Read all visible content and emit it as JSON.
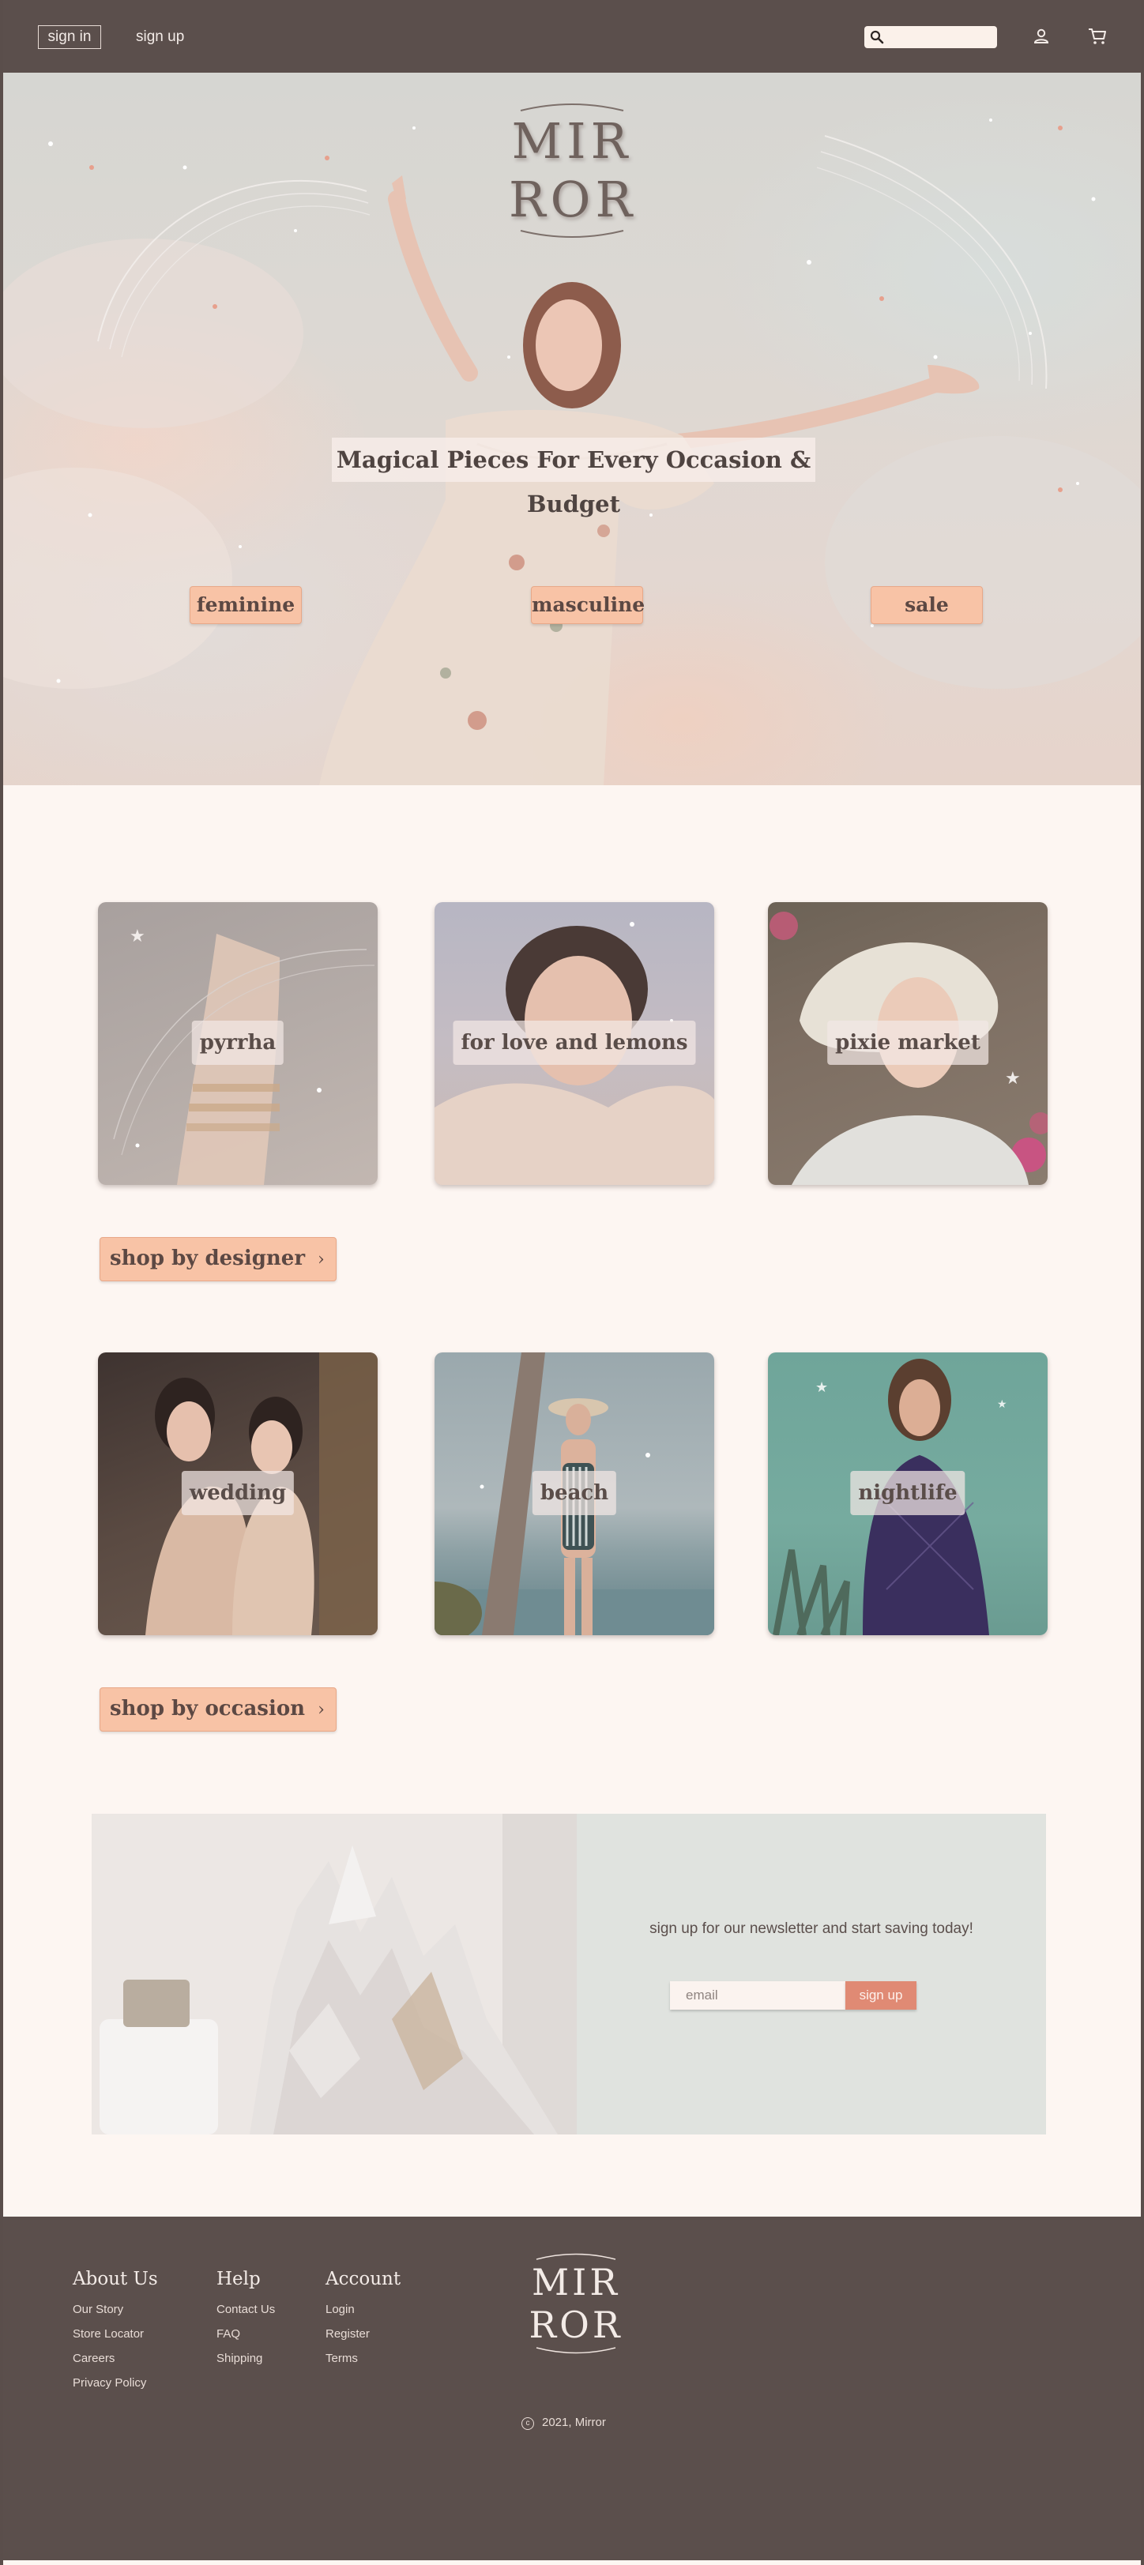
{
  "nav": {
    "sign_in": "sign in",
    "sign_up": "sign up",
    "search_placeholder": "",
    "icons": [
      "search-icon",
      "user-icon",
      "cart-icon"
    ]
  },
  "hero": {
    "logo_line1": "MIR",
    "logo_line2": "ROR",
    "tagline": "Magical Pieces For Every Occasion & Budget",
    "buttons": [
      "feminine",
      "masculine",
      "sale"
    ]
  },
  "designers": {
    "cards": [
      "pyrrha",
      "for love and lemons",
      "pixie market"
    ],
    "cta": "shop by designer"
  },
  "occasions": {
    "cards": [
      "wedding",
      "beach",
      "nightlife"
    ],
    "cta": "shop by occasion"
  },
  "newsletter": {
    "text": "sign up for our newsletter and start saving today!",
    "email_placeholder": "email",
    "button": "sign up"
  },
  "footer": {
    "columns": [
      {
        "title": "About Us",
        "links": [
          "Our Story",
          "Store Locator",
          "Careers",
          "Privacy Policy"
        ]
      },
      {
        "title": "Help",
        "links": [
          "Contact Us",
          "FAQ",
          "Shipping"
        ]
      },
      {
        "title": "Account",
        "links": [
          "Login",
          "Register",
          "Terms"
        ]
      }
    ],
    "logo_line1": "MIR",
    "logo_line2": "ROR",
    "copyright": "2021, Mirror"
  },
  "colors": {
    "nav_bg": "#5b4f4c",
    "page_bg": "#fdf6f2",
    "accent_peach": "#f8c3a6",
    "accent_coral": "#e08a74",
    "newsletter_bg": "#e0e3df"
  }
}
